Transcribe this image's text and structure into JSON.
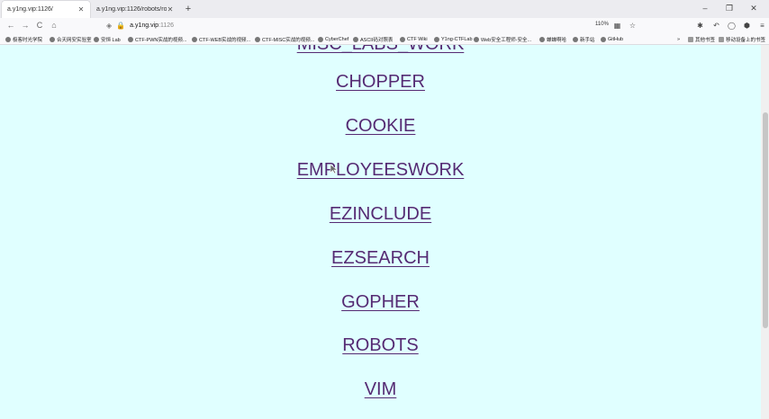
{
  "tabs": [
    {
      "title": "a.y1ng.vip:1126/",
      "active": true
    },
    {
      "title": "a.y1ng.vip:1126/robots/robots.txt#",
      "active": false
    }
  ],
  "new_tab_symbol": "+",
  "window_controls": [
    "–",
    "❐",
    "✕"
  ],
  "nav": {
    "back": "←",
    "forward": "→",
    "reload": "C",
    "home": "⌂",
    "url_host": "a.y1ng.vip",
    "url_port": ":1126",
    "zoom": "110%"
  },
  "toolbar_icons": [
    "qr-icon",
    "bookmark-star-icon",
    "extension-puzzle-icon",
    "undo-icon",
    "account-icon",
    "shield-addon-icon",
    "menu-icon"
  ],
  "bookmarks": [
    "极客时光学院",
    "合天网安实验室",
    "安恒 Lab",
    "CTF-PWN实战的视频...",
    "CTF-WEB实战的视频...",
    "CTF-MISC实战的视频...",
    "CyberChef",
    "ASCII码对照表",
    "CTF Wiki",
    "Y1ng-CTFLab",
    "Web安全工程师-安全...",
    "蝉蝉啊哈",
    "新手站",
    "GitHub"
  ],
  "bookmarks_overflow": "»",
  "bookmarks_right": [
    "其他书签",
    "移动设备上的书签"
  ],
  "links_partial_top": "MISC_LABS_WORK",
  "links": [
    "CHOPPER",
    "COOKIE",
    "EMPLOYEESWORK",
    "EZINCLUDE",
    "EZSEARCH",
    "GOPHER",
    "ROBOTS",
    "VIM"
  ],
  "colors": {
    "page_bg": "#e0ffff",
    "visited_link": "#552a73",
    "chrome_bg": "#f9f9fb",
    "tabstrip_bg": "#ececf0"
  }
}
